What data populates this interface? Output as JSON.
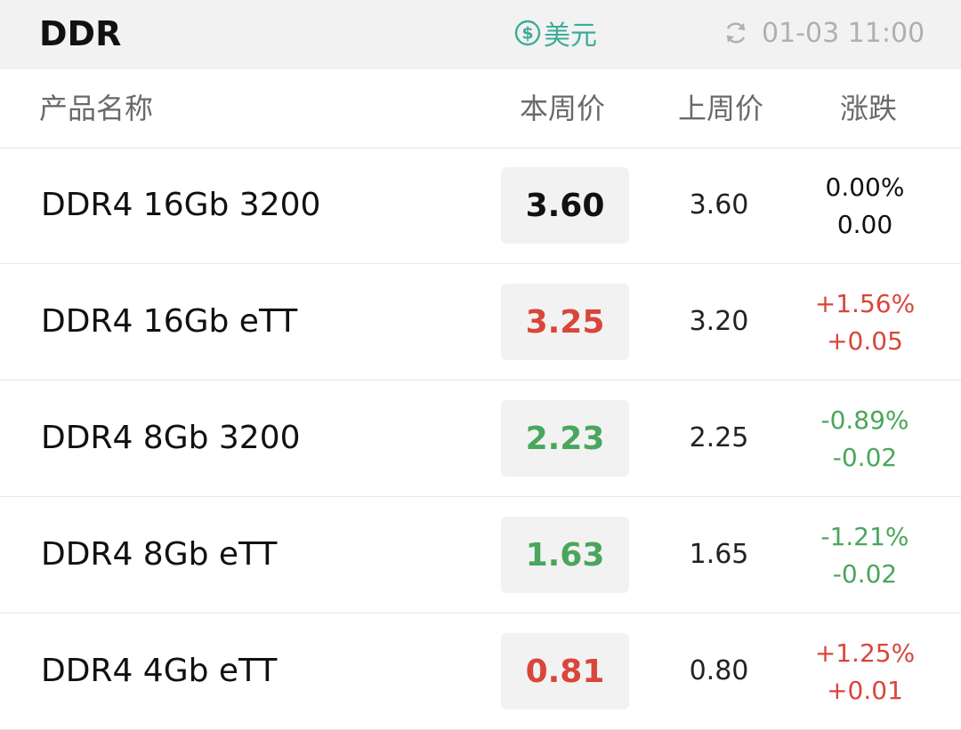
{
  "header": {
    "title": "DDR",
    "currency_label": "美元",
    "currency_icon": "dollar-coin-icon",
    "refresh_icon": "refresh-icon",
    "updated_time": "01-03 11:00"
  },
  "columns": {
    "name": "产品名称",
    "current": "本周价",
    "previous": "上周价",
    "change": "涨跌"
  },
  "colors": {
    "up": "#d9463a",
    "down": "#4aa65c",
    "flat": "#111111",
    "accent": "#3dab9a"
  },
  "rows": [
    {
      "name": "DDR4 16Gb 3200",
      "current": "3.60",
      "previous": "3.60",
      "change_pct": "0.00%",
      "change_abs": "0.00",
      "trend": "flat"
    },
    {
      "name": "DDR4 16Gb eTT",
      "current": "3.25",
      "previous": "3.20",
      "change_pct": "+1.56%",
      "change_abs": "+0.05",
      "trend": "up"
    },
    {
      "name": "DDR4 8Gb 3200",
      "current": "2.23",
      "previous": "2.25",
      "change_pct": "-0.89%",
      "change_abs": "-0.02",
      "trend": "down"
    },
    {
      "name": "DDR4 8Gb eTT",
      "current": "1.63",
      "previous": "1.65",
      "change_pct": "-1.21%",
      "change_abs": "-0.02",
      "trend": "down"
    },
    {
      "name": "DDR4 4Gb eTT",
      "current": "0.81",
      "previous": "0.80",
      "change_pct": "+1.25%",
      "change_abs": "+0.01",
      "trend": "up"
    }
  ]
}
